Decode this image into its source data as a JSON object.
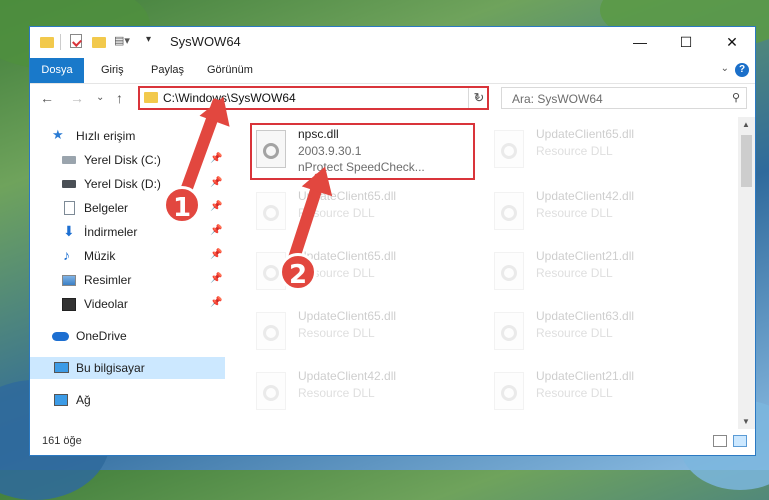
{
  "window": {
    "title": "SysWOW64",
    "controls": {
      "minimize": "—",
      "maximize": "☐",
      "close": "✕"
    }
  },
  "ribbon": {
    "tabs": [
      "Dosya",
      "Giriş",
      "Paylaş",
      "Görünüm"
    ],
    "help": "?"
  },
  "nav": {
    "back": "←",
    "forward": "→",
    "recent": "⌄",
    "up": "↑",
    "address": "C:\\Windows\\SysWOW64",
    "search_placeholder": "Ara: SysWOW64"
  },
  "sidebar": {
    "items": [
      {
        "label": "Hızlı erişim",
        "icon": "star-icon",
        "pinned": false
      },
      {
        "label": "Yerel Disk (C:)",
        "icon": "drive-icon",
        "pinned": true
      },
      {
        "label": "Yerel Disk (D:)",
        "icon": "drive-icon",
        "pinned": true
      },
      {
        "label": "Belgeler",
        "icon": "documents-icon",
        "pinned": true
      },
      {
        "label": "İndirmeler",
        "icon": "downloads-icon",
        "pinned": true
      },
      {
        "label": "Müzik",
        "icon": "music-icon",
        "pinned": true
      },
      {
        "label": "Resimler",
        "icon": "pictures-icon",
        "pinned": true
      },
      {
        "label": "Videolar",
        "icon": "videos-icon",
        "pinned": true
      },
      {
        "label": "OneDrive",
        "icon": "onedrive-icon",
        "pinned": false
      },
      {
        "label": "Bu bilgisayar",
        "icon": "computer-icon",
        "pinned": false,
        "selected": true
      },
      {
        "label": "Ağ",
        "icon": "network-icon",
        "pinned": false
      }
    ]
  },
  "files": {
    "highlighted": {
      "name": "npsc.dll",
      "version": "2003.9.30.1",
      "description": "nProtect SpeedCheck..."
    },
    "left_column": [
      {
        "name": "UpdateClient65.dll",
        "type": "Resource DLL"
      },
      {
        "name": "UpdateClient65.dll",
        "type": "Resource DLL"
      },
      {
        "name": "UpdateClient65.dll",
        "type": "Resource DLL"
      },
      {
        "name": "UpdateClient42.dll",
        "type": "Resource DLL"
      }
    ],
    "right_column": [
      {
        "name": "UpdateClient65.dll",
        "type": "Resource DLL"
      },
      {
        "name": "UpdateClient42.dll",
        "type": "Resource DLL"
      },
      {
        "name": "UpdateClient21.dll",
        "type": "Resource DLL"
      },
      {
        "name": "UpdateClient63.dll",
        "type": "Resource DLL"
      },
      {
        "name": "UpdateClient21.dll",
        "type": "Resource DLL"
      }
    ]
  },
  "status": {
    "count": "161 öğe"
  },
  "annotations": {
    "step1": "1",
    "step2": "2"
  },
  "colors": {
    "accent": "#1979ca",
    "highlight": "#d9343a",
    "arrow": "#e2473f"
  }
}
